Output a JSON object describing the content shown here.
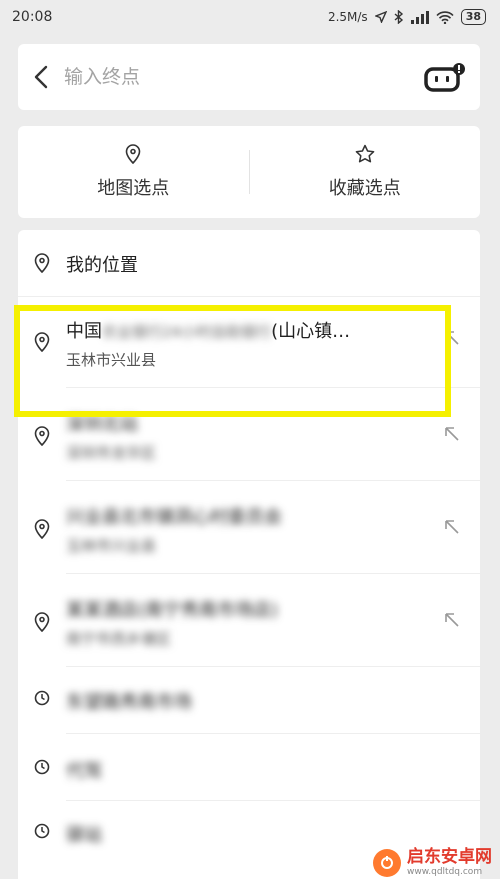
{
  "status_bar": {
    "time": "20:08",
    "network_speed": "2.5M/s",
    "battery": "38"
  },
  "search": {
    "placeholder": "输入终点"
  },
  "pick_options": [
    {
      "label": "地图选点",
      "icon": "location-pin-icon"
    },
    {
      "label": "收藏选点",
      "icon": "star-icon"
    }
  ],
  "list": {
    "my_location": "我的位置",
    "places": [
      {
        "title_prefix": "中国",
        "title_blurred": "农业银行24小时自助银行",
        "title_suffix": "(山心镇…",
        "subtitle": "玉林市兴业县"
      },
      {
        "title_blurred": "深圳北站",
        "subtitle_blurred": "深圳市龙华区"
      },
      {
        "title_blurred": "兴业县北市镇洞心村委员会",
        "subtitle_blurred": "玉林市兴业县"
      },
      {
        "title_blurred": "某某酒店(南宁秀南市场店)",
        "subtitle_blurred": "南宁市西乡塘区"
      }
    ],
    "history": [
      {
        "title_blurred": "东望路秀南市场"
      },
      {
        "title_blurred": "代驾"
      },
      {
        "title_blurred": "驿站"
      }
    ]
  },
  "watermark": {
    "name": "启东安卓网",
    "url": "www.qdltdq.com"
  }
}
